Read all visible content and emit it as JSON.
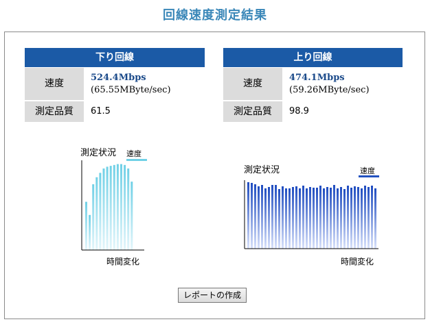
{
  "page": {
    "title": "回線速度測定結果"
  },
  "download": {
    "header": "下り回線",
    "speed_label": "速度",
    "speed_mbps": "524.4Mbps",
    "speed_mbyte": "(65.55MByte/sec)",
    "quality_label": "測定品質",
    "quality_value": "61.5",
    "chart_title": "測定状況",
    "legend": "速度",
    "xlabel": "時間変化"
  },
  "upload": {
    "header": "上り回線",
    "speed_label": "速度",
    "speed_mbps": "474.1Mbps",
    "speed_mbyte": "(59.26MByte/sec)",
    "quality_label": "測定品質",
    "quality_value": "98.9",
    "chart_title": "測定状況",
    "legend": "速度",
    "xlabel": "時間変化"
  },
  "report_button": "レポートの作成",
  "colors": {
    "accent": "#1b5aa6",
    "title": "#3a87b8",
    "download_bar": "#6fd0e6",
    "upload_bar": "#2352c0"
  },
  "chart_data": [
    {
      "type": "bar",
      "chart": "download",
      "values": [
        0.55,
        0.4,
        0.75,
        0.83,
        0.88,
        0.93,
        0.95,
        0.96,
        0.97,
        0.98,
        0.98,
        0.97,
        0.93,
        0.78
      ],
      "ylim": [
        0,
        1
      ]
    },
    {
      "type": "bar",
      "chart": "upload",
      "values": [
        0.97,
        0.96,
        0.94,
        0.91,
        0.93,
        0.88,
        0.9,
        0.93,
        0.93,
        0.87,
        0.91,
        0.88,
        0.88,
        0.9,
        0.91,
        0.88,
        0.92,
        0.88,
        0.9,
        0.89,
        0.89,
        0.92,
        0.88,
        0.9,
        0.89,
        0.93,
        0.88,
        0.9,
        0.87,
        0.92,
        0.89,
        0.91,
        0.9,
        0.88,
        0.92,
        0.9,
        0.92,
        0.88
      ],
      "ylim": [
        0,
        1
      ]
    }
  ]
}
